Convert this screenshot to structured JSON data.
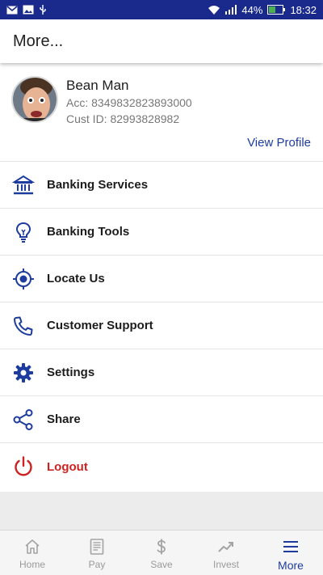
{
  "status_bar": {
    "battery": "44%",
    "time": "18:32"
  },
  "app_bar": {
    "title": "More..."
  },
  "profile": {
    "name": "Bean Man",
    "account": "Acc: 8349832823893000",
    "customer_id": "Cust ID: 82993828982",
    "view_profile": "View Profile"
  },
  "menu": [
    {
      "label": "Banking Services",
      "icon": "bank-icon"
    },
    {
      "label": "Banking Tools",
      "icon": "lightbulb-icon"
    },
    {
      "label": "Locate Us",
      "icon": "location-target-icon"
    },
    {
      "label": "Customer Support",
      "icon": "phone-icon"
    },
    {
      "label": "Settings",
      "icon": "gear-icon"
    },
    {
      "label": "Share",
      "icon": "share-icon"
    },
    {
      "label": "Logout",
      "icon": "power-icon"
    }
  ],
  "bottom_nav": [
    {
      "label": "Home",
      "icon": "home-icon"
    },
    {
      "label": "Pay",
      "icon": "receipt-icon"
    },
    {
      "label": "Save",
      "icon": "dollar-icon"
    },
    {
      "label": "Invest",
      "icon": "trending-up-icon"
    },
    {
      "label": "More",
      "icon": "menu-icon",
      "active": true
    }
  ],
  "colors": {
    "primary": "#1d3c9e",
    "status_bar": "#1a2a8c",
    "logout": "#cc2222"
  }
}
